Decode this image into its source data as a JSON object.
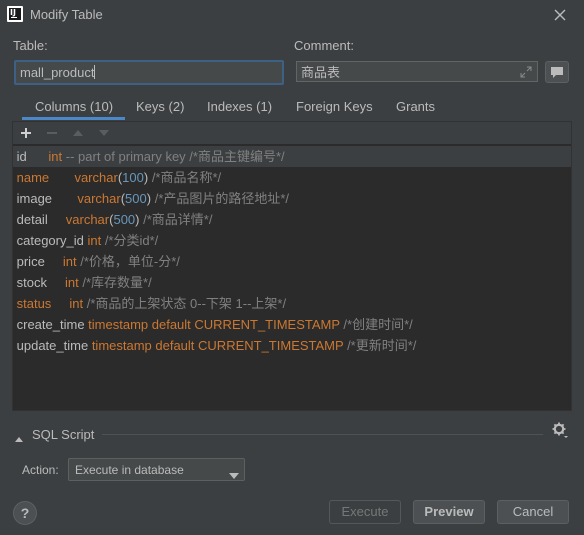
{
  "window": {
    "title": "Modify Table"
  },
  "form": {
    "table_label": "Table:",
    "table_value": "mall_product",
    "comment_label": "Comment:",
    "comment_value": "商品表"
  },
  "tabs": [
    {
      "label": "Columns (10)",
      "active": true
    },
    {
      "label": "Keys (2)",
      "active": false
    },
    {
      "label": "Indexes (1)",
      "active": false
    },
    {
      "label": "Foreign Keys",
      "active": false
    },
    {
      "label": "Grants",
      "active": false
    }
  ],
  "columns": [
    {
      "name": "id",
      "pad": "      ",
      "type": "int",
      "len": "",
      "extra": " -- part of primary key",
      "comment": " /*商品主键编号*/",
      "error": false,
      "selected": true
    },
    {
      "name": "name",
      "pad": "       ",
      "type": "varchar",
      "len": "100",
      "extra": "",
      "comment": " /*商品名称*/",
      "error": true,
      "selected": false
    },
    {
      "name": "image",
      "pad": "       ",
      "type": "varchar",
      "len": "500",
      "extra": "",
      "comment": " /*产品图片的路径地址*/",
      "error": false,
      "selected": false
    },
    {
      "name": "detail",
      "pad": "     ",
      "type": "varchar",
      "len": "500",
      "extra": "",
      "comment": " /*商品详情*/",
      "error": false,
      "selected": false
    },
    {
      "name": "category_id",
      "pad": " ",
      "type": "int",
      "len": "",
      "extra": "",
      "comment": " /*分类id*/",
      "error": false,
      "selected": false
    },
    {
      "name": "price",
      "pad": "     ",
      "type": "int",
      "len": "",
      "extra": "",
      "comment": " /*价格，单位-分*/",
      "error": false,
      "selected": false
    },
    {
      "name": "stock",
      "pad": "     ",
      "type": "int",
      "len": "",
      "extra": "",
      "comment": " /*库存数量*/",
      "error": false,
      "selected": false
    },
    {
      "name": "status",
      "pad": "     ",
      "type": "int",
      "len": "",
      "extra": "",
      "comment": " /*商品的上架状态 0--下架 1--上架*/",
      "error": true,
      "selected": false
    },
    {
      "name": "create_time",
      "pad": " ",
      "type": "timestamp default CURRENT_TIMESTAMP",
      "len": "",
      "extra": "",
      "comment": " /*创建时间*/",
      "error": false,
      "selected": false
    },
    {
      "name": "update_time",
      "pad": " ",
      "type": "timestamp default CURRENT_TIMESTAMP",
      "len": "",
      "extra": "",
      "comment": " /*更新时间*/",
      "error": false,
      "selected": false
    }
  ],
  "sql_script": {
    "label": "SQL Script",
    "expanded": false
  },
  "action": {
    "label": "Action:",
    "value": "Execute in database"
  },
  "buttons": {
    "help": "?",
    "execute": "Execute",
    "preview": "Preview",
    "cancel": "Cancel"
  },
  "colors": {
    "background": "#3c3f41",
    "accent": "#4a88c7",
    "keyword": "#cc7832",
    "number": "#6897bb",
    "comment": "#808080"
  },
  "icons": [
    "app-icon",
    "close-icon",
    "expand-icon",
    "comment-icon",
    "add-icon",
    "remove-icon",
    "move-up-icon",
    "move-down-icon",
    "collapse-arrow-icon",
    "gear-icon",
    "chevron-down-icon"
  ]
}
